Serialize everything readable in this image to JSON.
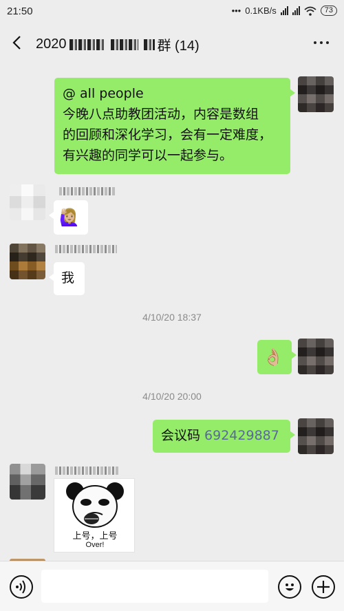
{
  "status_bar": {
    "time": "21:50",
    "network_speed": "0.1KB/s",
    "battery": "73"
  },
  "header": {
    "title_prefix": "2020",
    "title_suffix": "群 (14)",
    "icons": [
      "back-arrow-icon",
      "more-dots-icon"
    ]
  },
  "messages": {
    "m1": {
      "lines": [
        "@ all people",
        "今晚八点助教团活动，内容是数组",
        "的回顾和深化学习，会有一定难度，",
        "有兴趣的同学可以一起参与。"
      ]
    },
    "m2": {
      "emoji": "🙋🏼‍♀️"
    },
    "m3": {
      "text": "我"
    },
    "ts1": "4/10/20 18:37",
    "m4": {
      "emoji": "👌🏼"
    },
    "ts2": "4/10/20 20:00",
    "m5": {
      "label": "会议码 ",
      "code": "692429887"
    },
    "m6": {
      "caption_line1": "上号，上号",
      "caption_line2": "Over!"
    }
  },
  "input_bar": {
    "icons": [
      "voice-icon",
      "emoji-icon",
      "plus-icon"
    ]
  },
  "colors": {
    "outgoing_bubble": "#95ec69",
    "incoming_bubble": "#ffffff",
    "background": "#ededed",
    "link": "#576b95"
  }
}
